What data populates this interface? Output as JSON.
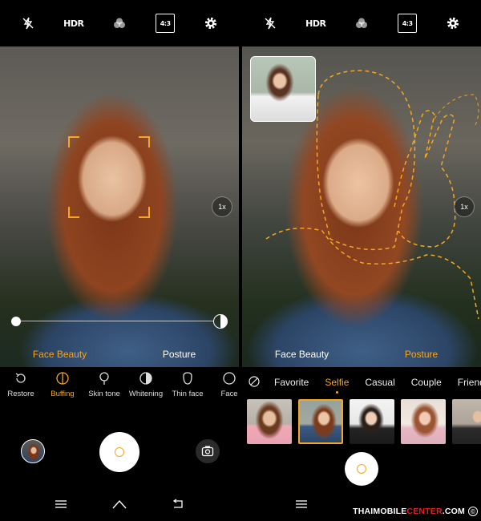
{
  "left": {
    "topbar": {
      "hdr_label": "HDR",
      "ratio_label": "4:3"
    },
    "zoom_label": "1x",
    "modes": [
      {
        "label": "Face Beauty",
        "active": true
      },
      {
        "label": "Posture",
        "active": false
      }
    ],
    "tools": [
      {
        "label": "Restore",
        "icon": "restore-icon",
        "active": false
      },
      {
        "label": "Buffing",
        "icon": "buffing-icon",
        "active": true
      },
      {
        "label": "Skin tone",
        "icon": "skin-tone-icon",
        "active": false
      },
      {
        "label": "Whitening",
        "icon": "whitening-icon",
        "active": false
      },
      {
        "label": "Thin face",
        "icon": "thin-face-icon",
        "active": false
      },
      {
        "label": "Face",
        "icon": "face-icon",
        "active": false
      }
    ]
  },
  "right": {
    "topbar": {
      "hdr_label": "HDR",
      "ratio_label": "4:3"
    },
    "zoom_label": "1x",
    "modes": [
      {
        "label": "Face Beauty",
        "active": false
      },
      {
        "label": "Posture",
        "active": true
      }
    ],
    "categories": [
      {
        "label": "Favorite",
        "active": false
      },
      {
        "label": "Selfie",
        "active": true
      },
      {
        "label": "Casual",
        "active": false
      },
      {
        "label": "Couple",
        "active": false
      },
      {
        "label": "Friends",
        "active": false
      }
    ]
  },
  "watermark": {
    "part1": "THAIMOBILE",
    "part2": "CENTER",
    "part3": ".COM",
    "symbol": "©"
  },
  "colors": {
    "accent": "#f5a623",
    "background": "#000000"
  }
}
